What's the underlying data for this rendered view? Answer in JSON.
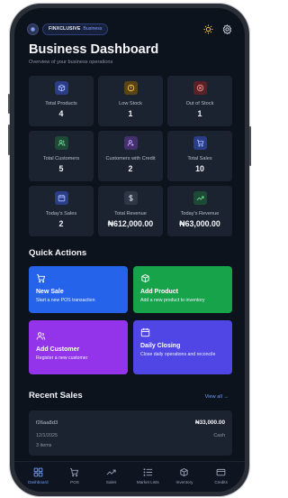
{
  "header": {
    "brand": "FINXCLUSIVE",
    "mode": "Business",
    "title": "Business Dashboard",
    "subtitle": "Overview of your business operations"
  },
  "stats": [
    {
      "label": "Total Products",
      "value": "4",
      "icon": "box-icon",
      "color": "#3b5bdb"
    },
    {
      "label": "Low Stock",
      "value": "1",
      "icon": "alert-icon",
      "color": "#b7791f"
    },
    {
      "label": "Out of Stock",
      "value": "1",
      "icon": "x-circle-icon",
      "color": "#c53030"
    },
    {
      "label": "Total Customers",
      "value": "5",
      "icon": "users-icon",
      "color": "#2f855a"
    },
    {
      "label": "Customers with Credit",
      "value": "2",
      "icon": "credit-icon",
      "color": "#805ad5"
    },
    {
      "label": "Total Sales",
      "value": "10",
      "icon": "cart-icon",
      "color": "#3b5bdb"
    },
    {
      "label": "Today's Sales",
      "value": "2",
      "icon": "calendar-icon",
      "color": "#3b5bdb"
    },
    {
      "label": "Total Revenue",
      "value": "₦612,000.00",
      "icon": "dollar-icon",
      "color": "#4a5568"
    },
    {
      "label": "Today's Revenue",
      "value": "₦63,000.00",
      "icon": "trend-up-icon",
      "color": "#2f855a"
    }
  ],
  "quick_actions": {
    "heading": "Quick Actions",
    "items": [
      {
        "title": "New Sale",
        "desc": "Start a new POS transaction",
        "color": "#2563eb"
      },
      {
        "title": "Add Product",
        "desc": "Add a new product to inventory",
        "color": "#16a34a"
      },
      {
        "title": "Add Customer",
        "desc": "Register a new customer",
        "color": "#9333ea"
      },
      {
        "title": "Daily Closing",
        "desc": "Close daily operations and reconcile",
        "color": "#4f46e5"
      }
    ]
  },
  "recent_sales": {
    "heading": "Recent Sales",
    "view_all": "View all →",
    "items": [
      {
        "id": "f26aa8d3",
        "amount": "₦33,000.00",
        "date": "12/1/2025",
        "method": "Cash",
        "items": "3 items"
      }
    ]
  },
  "nav": [
    {
      "label": "Dashboard",
      "icon": "grid-icon",
      "active": true
    },
    {
      "label": "POS",
      "icon": "cart-icon",
      "active": false
    },
    {
      "label": "Sales",
      "icon": "trend-up-icon",
      "active": false
    },
    {
      "label": "Market Lists",
      "icon": "list-icon",
      "active": false
    },
    {
      "label": "Inventory",
      "icon": "box-icon",
      "active": false
    },
    {
      "label": "Credits",
      "icon": "card-icon",
      "active": false
    }
  ],
  "colors": {
    "background": "#0d131c",
    "card": "#1c2330",
    "accent": "#6f9bff"
  }
}
